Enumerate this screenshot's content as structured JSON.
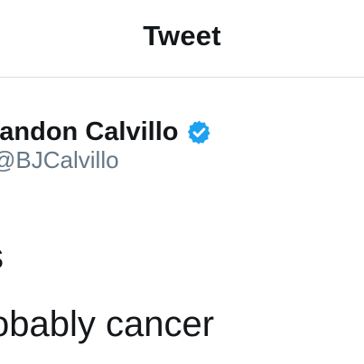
{
  "header": {
    "title": "Tweet"
  },
  "tweet": {
    "author": {
      "display_name": "randon Calvillo",
      "handle": "BJCalvillo",
      "verified_icon": "verified-badge-icon"
    },
    "text_lines": [
      "s",
      "obably cancer"
    ]
  },
  "colors": {
    "verified_blue": "#1da1f2",
    "handle_gray": "#657786",
    "divider": "#d8dde1"
  }
}
